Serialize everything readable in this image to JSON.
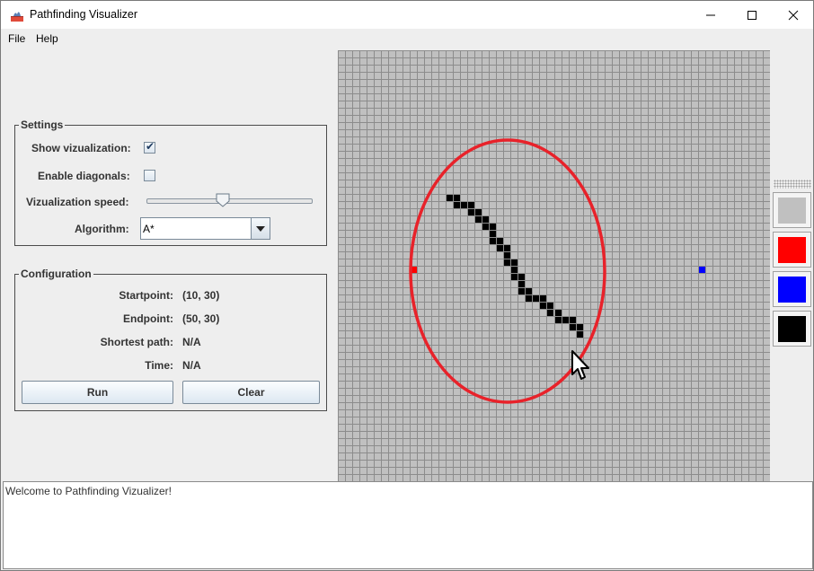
{
  "window": {
    "title": "Pathfinding Visualizer",
    "icon": "java-app-icon"
  },
  "menubar": {
    "items": [
      "File",
      "Help"
    ]
  },
  "settings": {
    "legend": "Settings",
    "show_visualization_label": "Show vizualization:",
    "show_visualization_checked": true,
    "enable_diagonals_label": "Enable diagonals:",
    "enable_diagonals_checked": false,
    "speed_label": "Vizualization speed:",
    "speed_level": 0.5,
    "algorithm_label": "Algorithm:",
    "algorithm_value": "A*"
  },
  "configuration": {
    "legend": "Configuration",
    "startpoint_label": "Startpoint:",
    "startpoint_value": "(10, 30)",
    "endpoint_label": "Endpoint:",
    "endpoint_value": "(50, 30)",
    "shortest_path_label": "Shortest path:",
    "shortest_path_value": "N/A",
    "time_label": "Time:",
    "time_value": "N/A",
    "run_label": "Run",
    "clear_label": "Clear"
  },
  "grid": {
    "columns": 60,
    "rows": 60,
    "cell_color": "#c0c0c0",
    "line_color": "#8c8c8c",
    "start_cell": [
      10,
      30
    ],
    "end_cell": [
      50,
      30
    ],
    "start_color": "#ff0000",
    "end_color": "#0000ff",
    "wall_color": "#000000",
    "walls": [
      [
        15,
        20
      ],
      [
        16,
        20
      ],
      [
        16,
        21
      ],
      [
        17,
        21
      ],
      [
        18,
        21
      ],
      [
        18,
        22
      ],
      [
        19,
        22
      ],
      [
        19,
        23
      ],
      [
        20,
        23
      ],
      [
        20,
        24
      ],
      [
        21,
        24
      ],
      [
        21,
        25
      ],
      [
        21,
        26
      ],
      [
        22,
        26
      ],
      [
        22,
        27
      ],
      [
        23,
        27
      ],
      [
        23,
        28
      ],
      [
        23,
        29
      ],
      [
        24,
        29
      ],
      [
        24,
        30
      ],
      [
        24,
        31
      ],
      [
        25,
        31
      ],
      [
        25,
        32
      ],
      [
        25,
        33
      ],
      [
        26,
        33
      ],
      [
        26,
        34
      ],
      [
        27,
        34
      ],
      [
        28,
        34
      ],
      [
        28,
        35
      ],
      [
        29,
        35
      ],
      [
        29,
        36
      ],
      [
        30,
        36
      ],
      [
        30,
        37
      ],
      [
        31,
        37
      ],
      [
        32,
        37
      ],
      [
        32,
        38
      ],
      [
        33,
        38
      ],
      [
        33,
        39
      ]
    ],
    "annotation_color": "#e8222a"
  },
  "palette": {
    "swatches": [
      {
        "name": "empty",
        "color": "#c0c0c0"
      },
      {
        "name": "start",
        "color": "#ff0000"
      },
      {
        "name": "end",
        "color": "#0000ff"
      },
      {
        "name": "wall",
        "color": "#000000"
      }
    ]
  },
  "console": {
    "text": "Welcome to Pathfinding Vizualizer!"
  }
}
